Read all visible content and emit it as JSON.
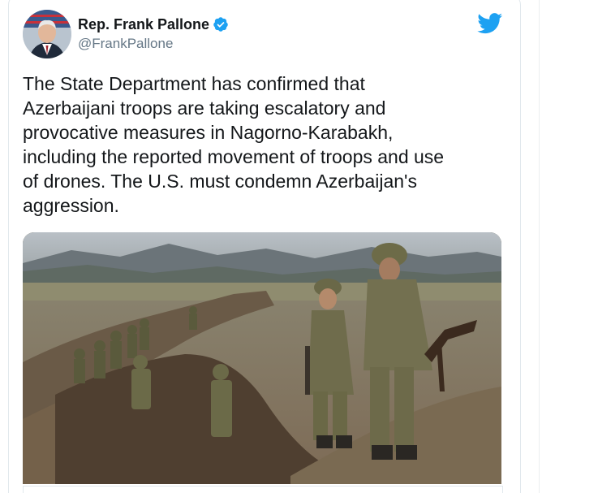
{
  "tweet": {
    "author": {
      "display_name": "Rep. Frank Pallone",
      "handle": "@FrankPallone",
      "verified": true,
      "avatar_icon": "avatar-photo"
    },
    "text": "The State Department has confirmed that\nAzerbaijani troops are taking escalatory and\nprovocative measures in Nagorno-Karabakh,\nincluding the reported movement of troops and use\nof drones. The U.S. must condemn Azerbaijan's\naggression.",
    "media": {
      "type": "photo",
      "icon": "photo-soldiers-trench"
    },
    "brand_icon": "twitter-bird-icon",
    "colors": {
      "brand": "#1da1f2",
      "text": "#14171a",
      "secondary": "#657786",
      "border": "#e1e8ed"
    }
  }
}
